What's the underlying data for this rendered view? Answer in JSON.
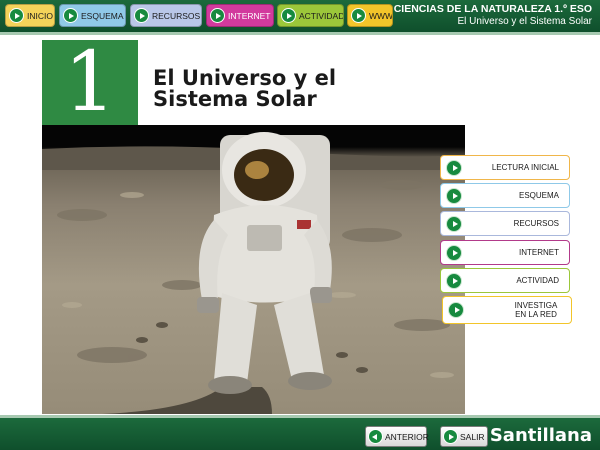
{
  "nav": {
    "items": [
      {
        "label": "INICIO",
        "color": "#f4d35a"
      },
      {
        "label": "ESQUEMA",
        "color": "#8fc9e8"
      },
      {
        "label": "RECURSOS",
        "color": "#b9c7e8"
      },
      {
        "label": "INTERNET",
        "color": "#d23a9d"
      },
      {
        "label": "ACTIVIDAD",
        "color": "#9bc73a"
      },
      {
        "label": "WWW",
        "color": "#f2c52a"
      }
    ]
  },
  "brand": {
    "title": "CIENCIAS DE LA NATURALEZA 1.º ESO",
    "subtitle": "El Universo y el Sistema Solar"
  },
  "unit": {
    "number": "1",
    "title_line1": "El Universo y el",
    "title_line2": "Sistema Solar"
  },
  "photo": {
    "icon": "astronaut-on-moon"
  },
  "side_menu": [
    {
      "label": "LECTURA INICIAL",
      "border": "#f0b64a"
    },
    {
      "label": "ESQUEMA",
      "border": "#8fc9e8"
    },
    {
      "label": "RECURSOS",
      "border": "#aab8dc"
    },
    {
      "label": "INTERNET",
      "border": "#b23a8a"
    },
    {
      "label": "ACTIVIDAD",
      "border": "#9bc73a"
    },
    {
      "label": "INVESTIGA EN LA RED",
      "border": "#f2c52a"
    }
  ],
  "footer": {
    "prev_label": "ANTERIOR",
    "exit_label": "SALIR",
    "publisher": "Santillana"
  },
  "colors": {
    "bar_green": "#1c6a3c",
    "unit_green": "#2f8a43",
    "play_green": "#178a3f"
  }
}
